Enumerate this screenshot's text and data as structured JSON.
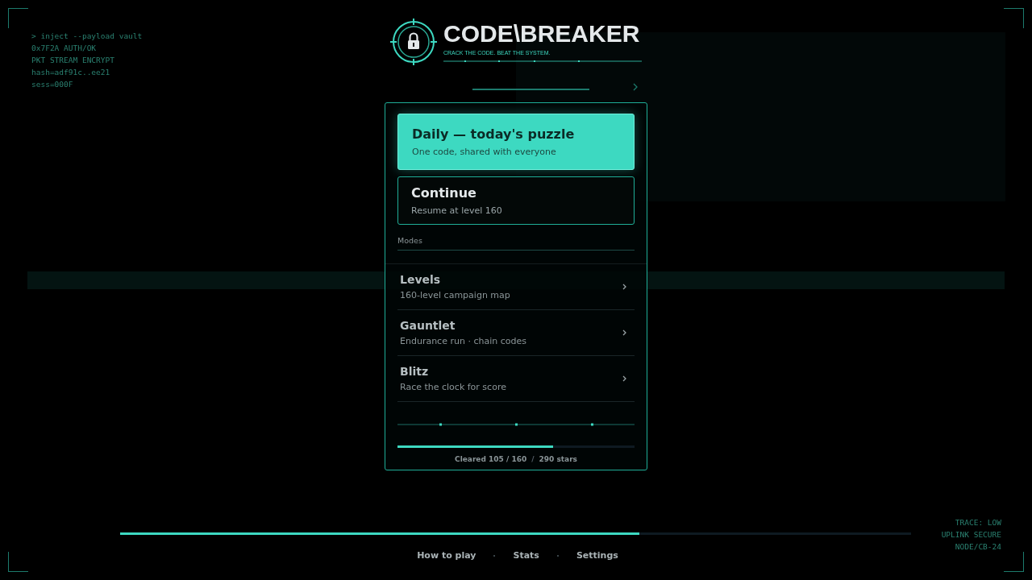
{
  "terminal_log": [
    "> inject --payload vault",
    "0x7F2A AUTH/OK",
    "PKT STREAM ENCRYPT",
    "hash=adf91c..ee21",
    "sess=000F"
  ],
  "logo": {
    "title": "CODE\\BREAKER",
    "tagline": "CRACK THE CODE. BEAT THE SYSTEM."
  },
  "primary_actions": [
    {
      "kind": "filled",
      "title": "Daily — today's puzzle",
      "subtitle": "One code, shared with everyone"
    },
    {
      "kind": "outlined",
      "title": "Continue",
      "subtitle": "Resume at level 160"
    }
  ],
  "modes": {
    "heading": "Modes",
    "items": [
      {
        "title": "Levels",
        "subtitle": "160-level campaign map"
      },
      {
        "title": "Gauntlet",
        "subtitle": "Endurance run · chain codes"
      },
      {
        "title": "Blitz",
        "subtitle": "Race the clock for score"
      }
    ]
  },
  "progress": {
    "level": 0.656,
    "cleared": "Cleared 105 / 160",
    "separator": "/",
    "stars": "290 stars"
  },
  "footer_bar": {
    "level": 0.656
  },
  "footer_links": [
    "How to play",
    "Stats",
    "Settings"
  ],
  "status_lines": [
    "TRACE: LOW",
    "UPLINK SECURE",
    "NODE/CB-24"
  ]
}
